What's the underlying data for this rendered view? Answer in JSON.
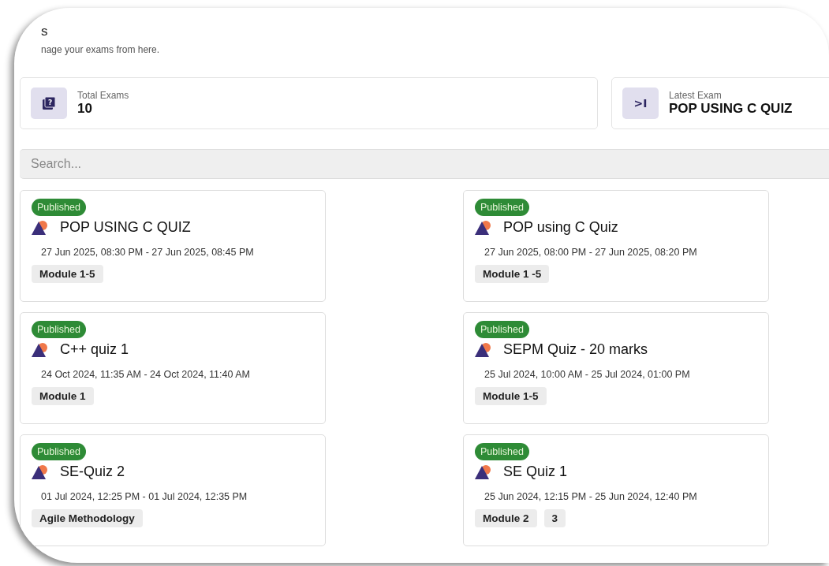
{
  "header": {
    "title": "s",
    "subtitle": "nage your exams from here."
  },
  "stats": [
    {
      "kind": "count",
      "label": "Total Exams",
      "value": "10",
      "icon": "?"
    },
    {
      "kind": "latest",
      "label": "Latest Exam",
      "value": "POP USING C QUIZ",
      "icon": ">I"
    }
  ],
  "search": {
    "placeholder": "Search..."
  },
  "exams": [
    {
      "status": "Published",
      "title": "POP USING C QUIZ",
      "time": "27 Jun 2025, 08:30 PM - 27 Jun 2025, 08:45 PM",
      "tags": [
        "Module 1-5"
      ]
    },
    {
      "status": "Published",
      "title": "POP using C Quiz",
      "time": "27 Jun 2025, 08:00 PM - 27 Jun 2025, 08:20 PM",
      "tags": [
        "Module 1 -5"
      ]
    },
    {
      "status": "Published",
      "title": "C++ quiz 1",
      "time": "24 Oct 2024, 11:35 AM - 24 Oct 2024, 11:40 AM",
      "tags": [
        "Module 1"
      ]
    },
    {
      "status": "Published",
      "title": "SEPM Quiz - 20 marks",
      "time": "25 Jul 2024, 10:00 AM - 25 Jul 2024, 01:00 PM",
      "tags": [
        "Module 1-5"
      ]
    },
    {
      "status": "Published",
      "title": "SE-Quiz 2",
      "time": "01 Jul 2024, 12:25 PM - 01 Jul 2024, 12:35 PM",
      "tags": [
        "Agile Methodology"
      ]
    },
    {
      "status": "Published",
      "title": "SE Quiz 1",
      "time": "25 Jun 2024, 12:15 PM - 25 Jun 2024, 12:40 PM",
      "tags": [
        "Module 2",
        "3"
      ]
    }
  ]
}
